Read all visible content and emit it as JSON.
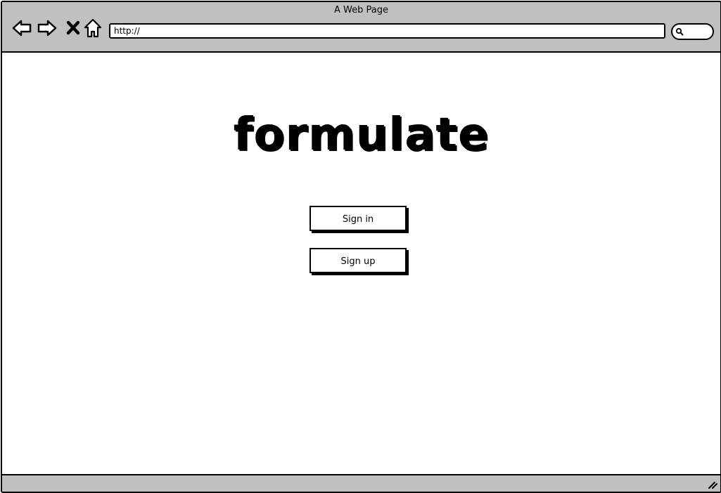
{
  "window": {
    "title": "A Web Page"
  },
  "toolbar": {
    "back_icon": "back-arrow-icon",
    "forward_icon": "forward-arrow-icon",
    "stop_icon": "close-icon",
    "home_icon": "home-icon",
    "address_value": "http://",
    "search_icon": "search-icon"
  },
  "main": {
    "logo_text": "formulate",
    "sign_in_label": "Sign in",
    "sign_up_label": "Sign up"
  },
  "colors": {
    "chrome": "#c0c0c0",
    "background": "#ffffff",
    "ink": "#000000"
  }
}
